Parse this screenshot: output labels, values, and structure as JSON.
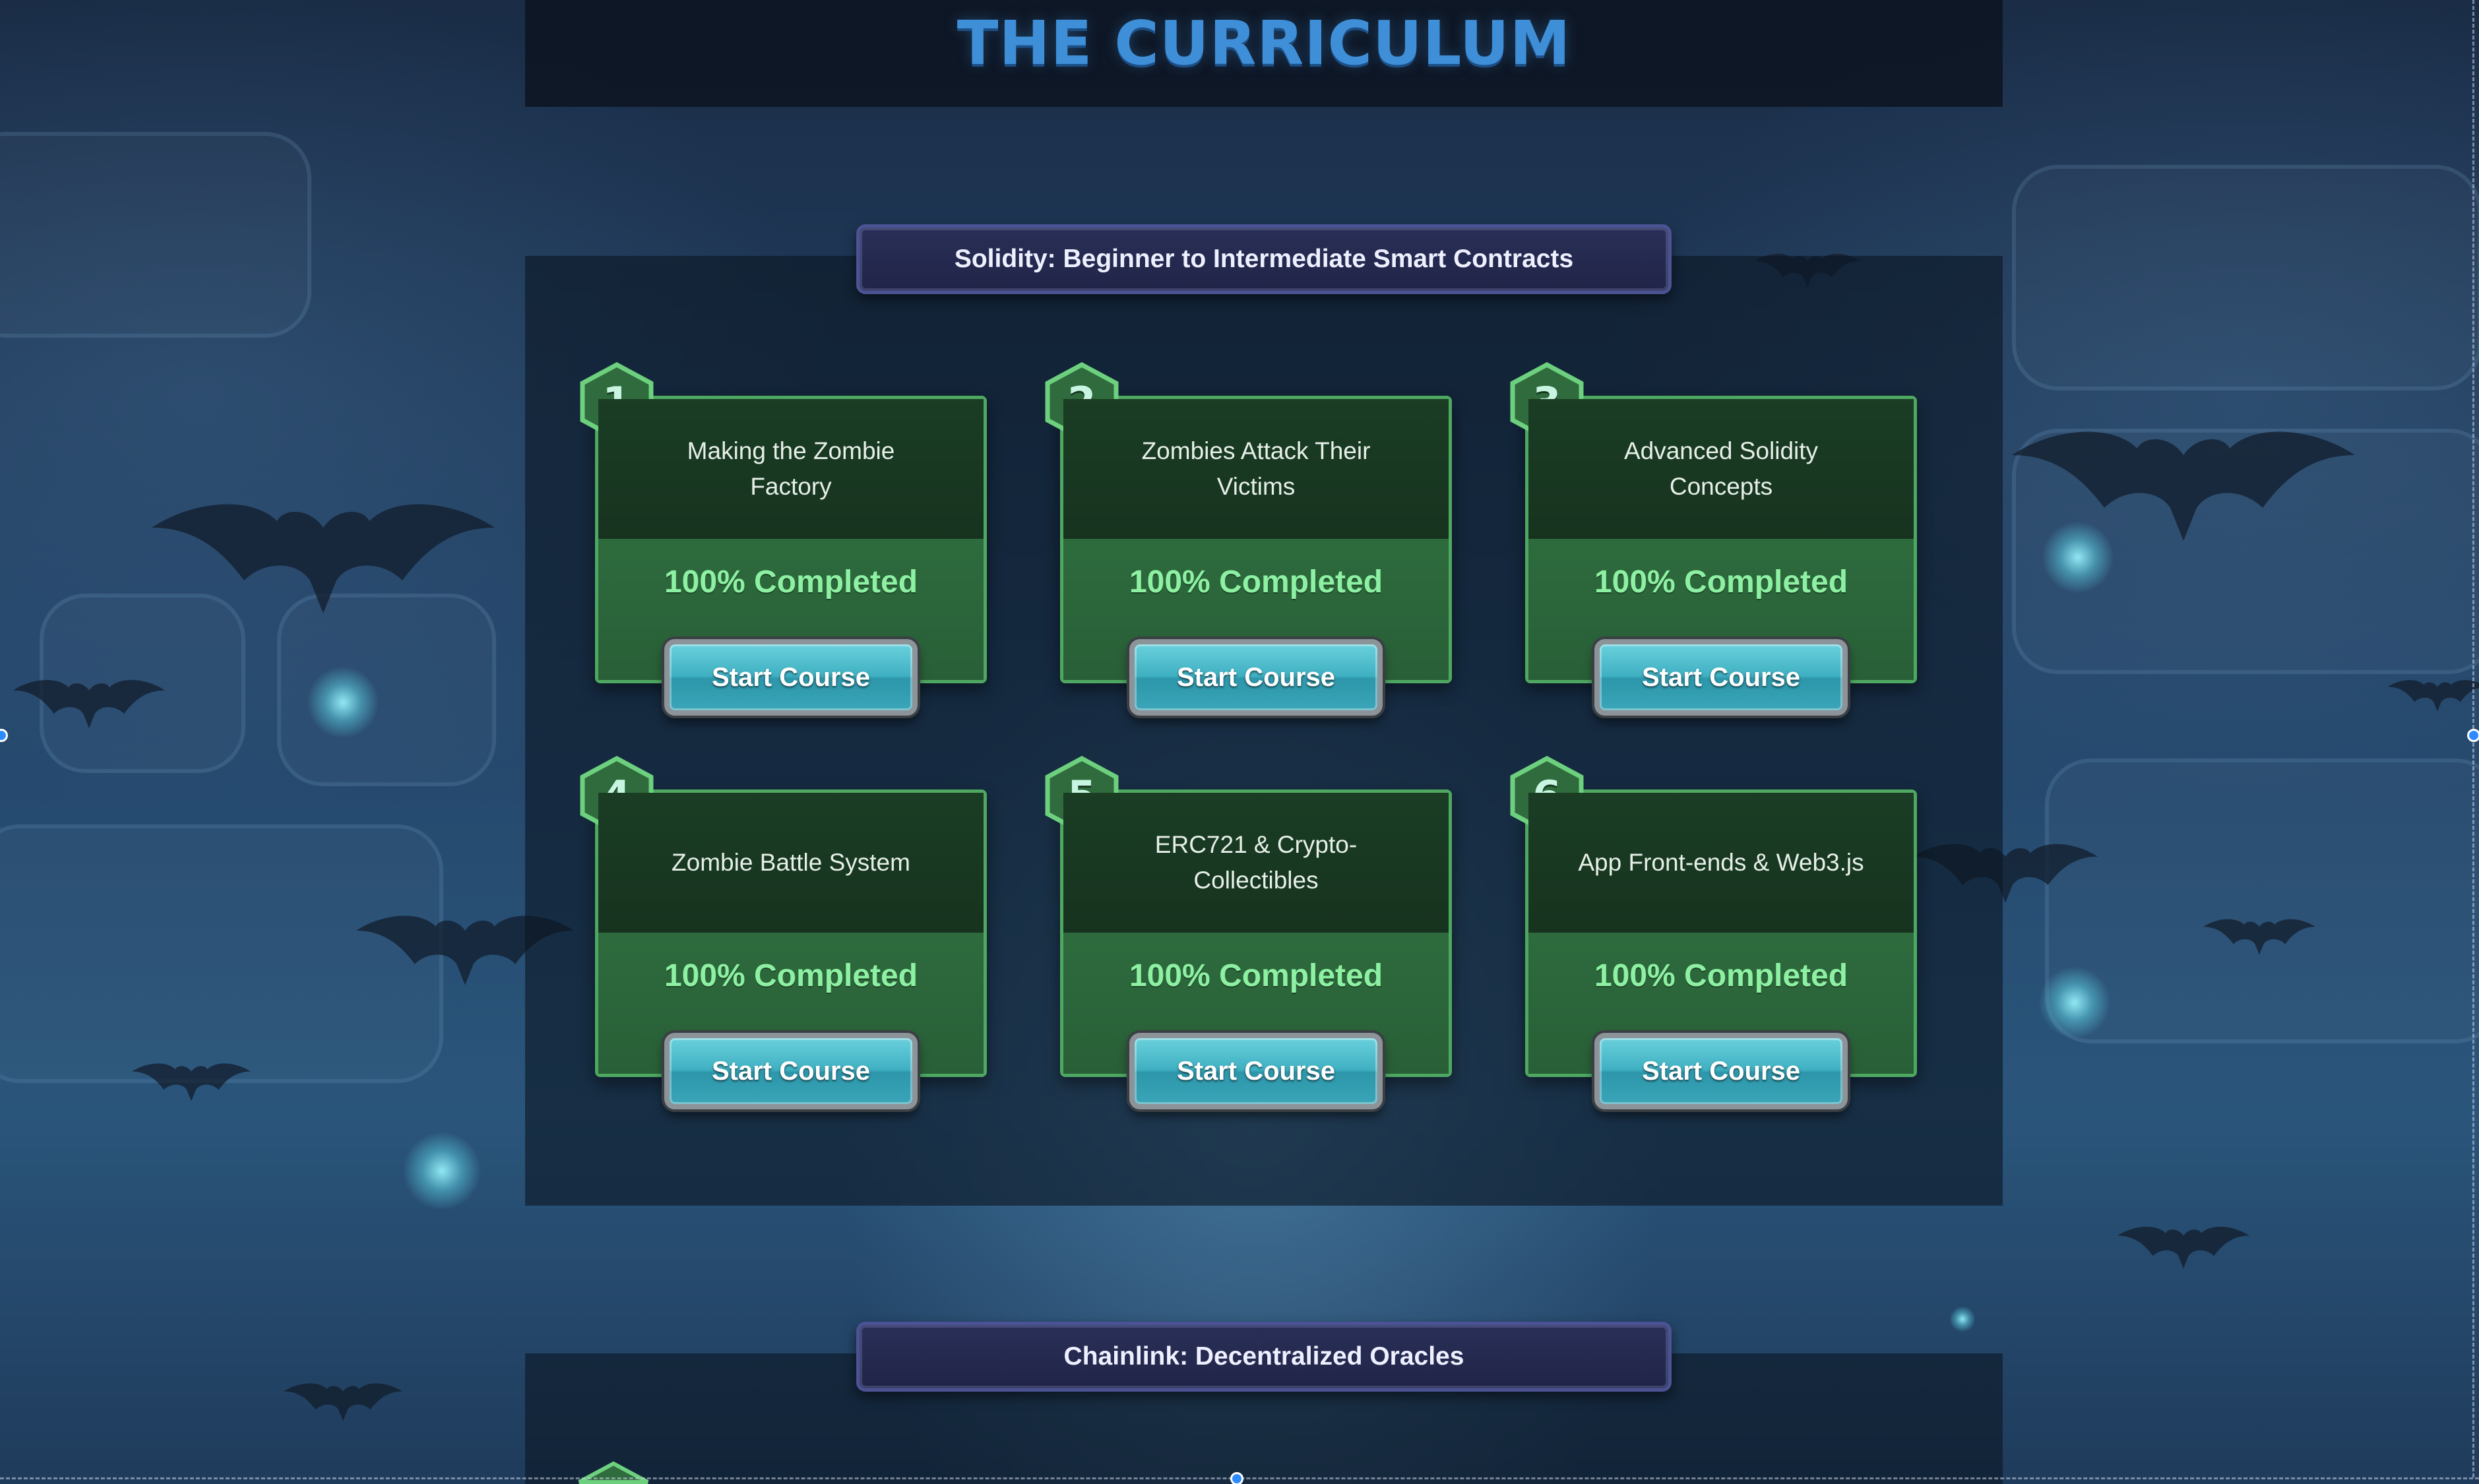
{
  "page": {
    "title": "THE CURRICULUM"
  },
  "sections": [
    {
      "label": "Solidity: Beginner to Intermediate Smart Contracts",
      "courses": [
        {
          "number": "1",
          "title": "Making the Zombie Factory",
          "progress": "100% Completed",
          "button": "Start Course"
        },
        {
          "number": "2",
          "title": "Zombies Attack Their Victims",
          "progress": "100% Completed",
          "button": "Start Course"
        },
        {
          "number": "3",
          "title": "Advanced Solidity Concepts",
          "progress": "100% Completed",
          "button": "Start Course"
        },
        {
          "number": "4",
          "title": "Zombie Battle System",
          "progress": "100% Completed",
          "button": "Start Course"
        },
        {
          "number": "5",
          "title": "ERC721 & Crypto-Collectibles",
          "progress": "100% Completed",
          "button": "Start Course"
        },
        {
          "number": "6",
          "title": "App Front-ends & Web3.js",
          "progress": "100% Completed",
          "button": "Start Course"
        }
      ]
    },
    {
      "label": "Chainlink: Decentralized Oracles"
    }
  ],
  "colors": {
    "title": "#3f8fd8",
    "card_border": "#4fa862",
    "progress_text": "#8df0a2",
    "button": "#3fb0c2",
    "section_label_bg": "#202447"
  },
  "icons": {
    "badge": "hexagon-badge-icon",
    "decor": "bat-icon"
  }
}
